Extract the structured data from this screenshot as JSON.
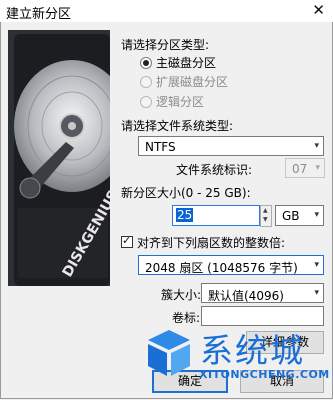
{
  "window": {
    "title": "建立新分区",
    "close_glyph": "✕"
  },
  "partition_type": {
    "label": "请选择分区类型:",
    "options": [
      {
        "label": "主磁盘分区",
        "selected": true,
        "enabled": true
      },
      {
        "label": "扩展磁盘分区",
        "selected": false,
        "enabled": false
      },
      {
        "label": "逻辑分区",
        "selected": false,
        "enabled": false
      }
    ]
  },
  "filesystem": {
    "label": "请选择文件系统类型:",
    "value": "NTFS",
    "id_label": "文件系统标识:",
    "id_value": "07"
  },
  "size": {
    "label": "新分区大小(0 - 25 GB):",
    "value": "25",
    "unit": "GB"
  },
  "align": {
    "label": "对齐到下列扇区数的整数倍:",
    "checked": true,
    "value": "2048 扇区 (1048576 字节)"
  },
  "cluster": {
    "label": "簇大小:",
    "value": "默认值(4096)"
  },
  "volume": {
    "label": "卷标:",
    "value": ""
  },
  "buttons": {
    "advanced": "详细参数",
    "ok": "确定",
    "cancel": "取消"
  },
  "brand": {
    "name": "DISKGENIUS"
  },
  "watermark": {
    "text": "系统城",
    "url": "XITONGCHENG.COM",
    "color": "#1a6fd6"
  },
  "icons": {
    "dropdown": "▾",
    "spin_up": "▲",
    "spin_down": "▼"
  }
}
